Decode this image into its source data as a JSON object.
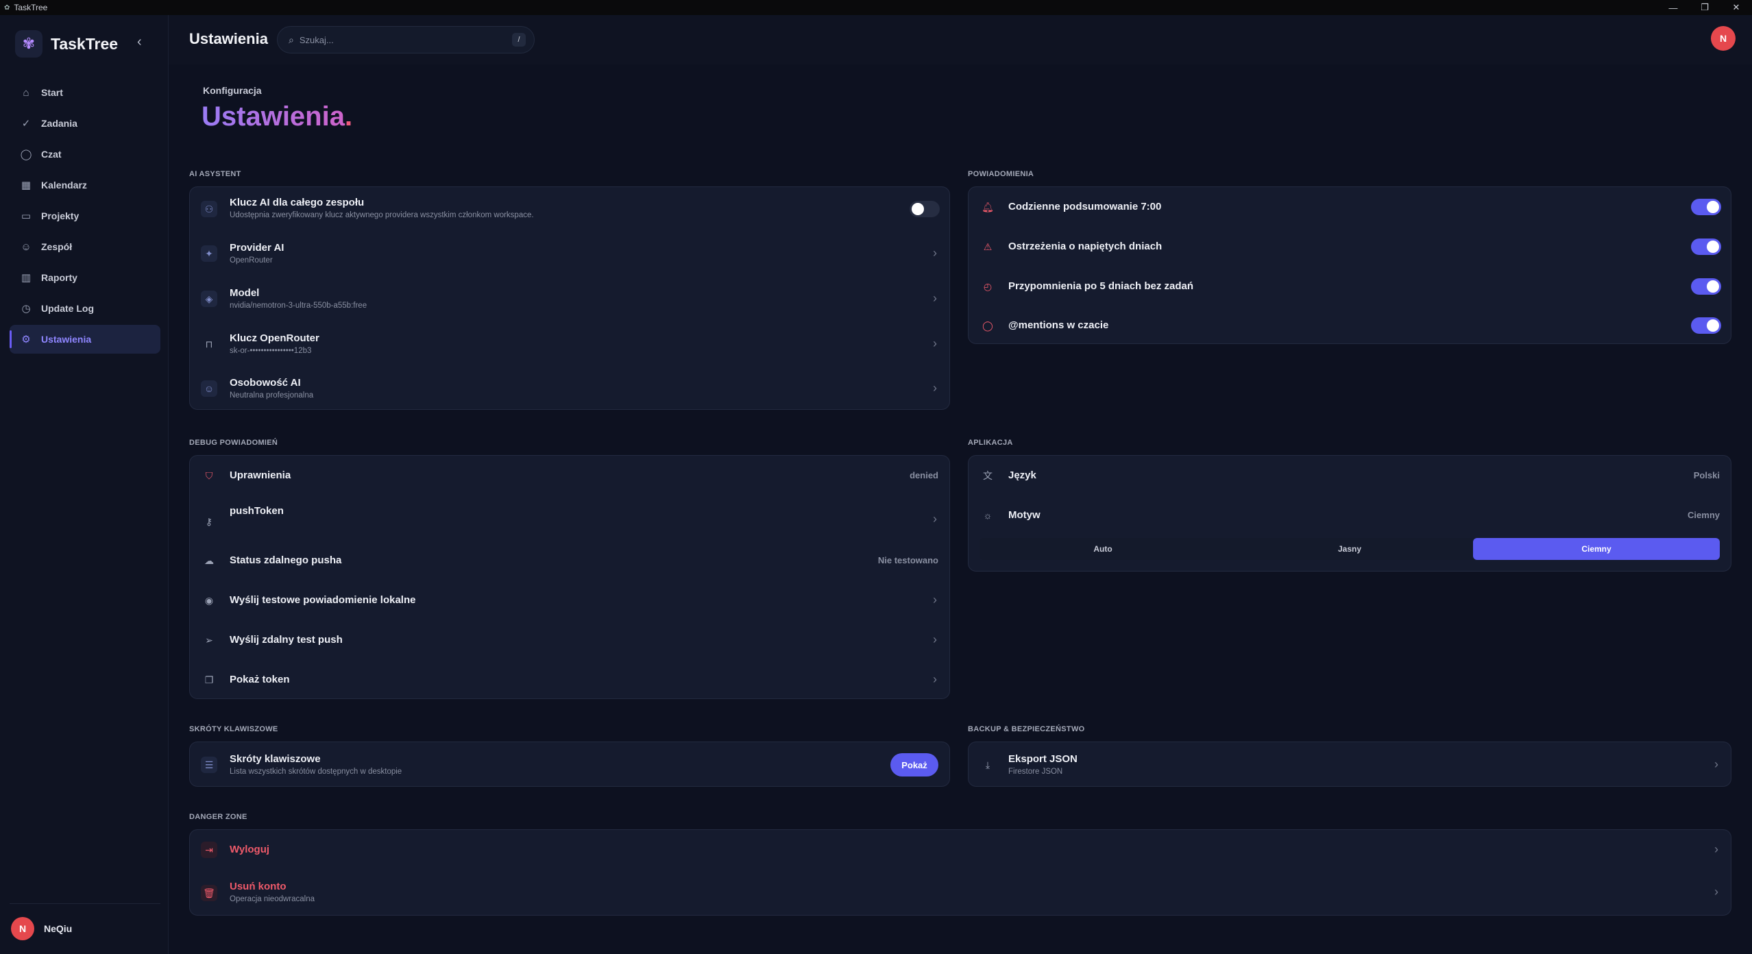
{
  "window": {
    "title": "TaskTree",
    "min": "—",
    "max": "❐",
    "close": "✕"
  },
  "brand": {
    "name": "TaskTree"
  },
  "sidebar": {
    "items": [
      {
        "label": "Start",
        "icon": "⌂"
      },
      {
        "label": "Zadania",
        "icon": "✓"
      },
      {
        "label": "Czat",
        "icon": "◯"
      },
      {
        "label": "Kalendarz",
        "icon": "▦"
      },
      {
        "label": "Projekty",
        "icon": "▭"
      },
      {
        "label": "Zespół",
        "icon": "☺"
      },
      {
        "label": "Raporty",
        "icon": "▥"
      },
      {
        "label": "Update Log",
        "icon": "◷"
      },
      {
        "label": "Ustawienia",
        "icon": "⚙"
      }
    ],
    "active": "Ustawienia"
  },
  "user": {
    "initial": "N",
    "name": "NeQiu"
  },
  "header": {
    "title": "Ustawienia",
    "search_placeholder": "Szukaj...",
    "shortcut": "/"
  },
  "page": {
    "eyebrow": "Konfiguracja",
    "title": "Ustawienia",
    "title_dot": "."
  },
  "ai": {
    "label": "AI ASYSTENT",
    "team_key": {
      "title": "Klucz AI dla całego zespołu",
      "sub": "Udostępnia zweryfikowany klucz aktywnego providera wszystkim członkom workspace."
    },
    "provider": {
      "title": "Provider AI",
      "sub": "OpenRouter"
    },
    "model": {
      "title": "Model",
      "sub": "nvidia/nemotron-3-ultra-550b-a55b:free"
    },
    "openrouter_key": {
      "title": "Klucz OpenRouter",
      "sub": "sk-or-••••••••••••••••12b3"
    },
    "personality": {
      "title": "Osobowość AI",
      "sub": "Neutralna profesjonalna"
    }
  },
  "notifications": {
    "label": "POWIADOMIENIA",
    "items": [
      {
        "title": "Codzienne podsumowanie 7:00",
        "on": true
      },
      {
        "title": "Ostrzeżenia o napiętych dniach",
        "on": true
      },
      {
        "title": "Przypomnienia po 5 dniach bez zadań",
        "on": true
      },
      {
        "title": "@mentions w czacie",
        "on": true
      }
    ]
  },
  "debug": {
    "label": "DEBUG POWIADOMIEŃ",
    "permissions": {
      "title": "Uprawnienia",
      "value": "denied"
    },
    "push_token": {
      "title": "pushToken"
    },
    "remote_status": {
      "title": "Status zdalnego pusha",
      "value": "Nie testowano"
    },
    "local_test": {
      "title": "Wyślij testowe powiadomienie lokalne"
    },
    "remote_test": {
      "title": "Wyślij zdalny test push"
    },
    "show_token": {
      "title": "Pokaż token"
    }
  },
  "app": {
    "label": "APLIKACJA",
    "language": {
      "title": "Język",
      "value": "Polski"
    },
    "theme": {
      "title": "Motyw",
      "value": "Ciemny"
    },
    "theme_options": [
      "Auto",
      "Jasny",
      "Ciemny"
    ],
    "theme_selected": "Ciemny"
  },
  "shortcuts": {
    "label": "SKRÓTY KLAWISZOWE",
    "title": "Skróty klawiszowe",
    "sub": "Lista wszystkich skrótów dostępnych w desktopie",
    "button": "Pokaż"
  },
  "backup": {
    "label": "BACKUP & BEZPIECZEŃSTWO",
    "title": "Eksport JSON",
    "sub": "Firestore JSON"
  },
  "danger": {
    "label": "DANGER ZONE",
    "logout": {
      "title": "Wyloguj"
    },
    "delete": {
      "title": "Usuń konto",
      "sub": "Operacja nieodwracalna"
    }
  },
  "colors": {
    "accent": "#5b5bf0",
    "danger": "#ef5a6a",
    "background": "#0d1120",
    "card": "#151b2e"
  }
}
